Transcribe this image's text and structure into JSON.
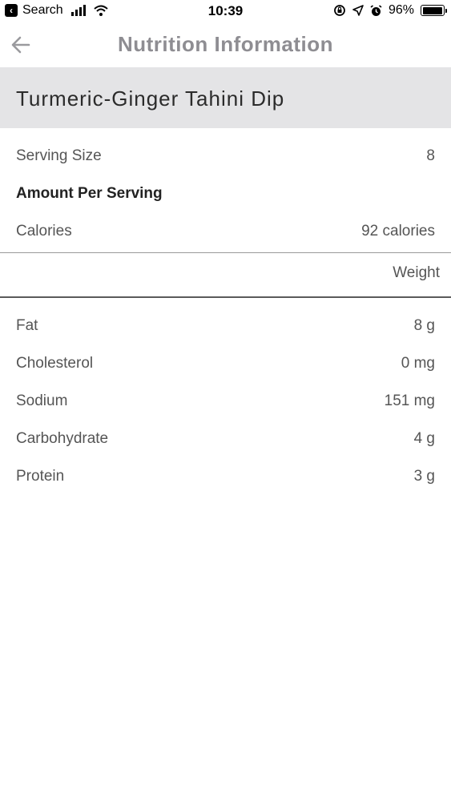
{
  "status_bar": {
    "back_app": "Search",
    "time": "10:39",
    "battery": "96%",
    "battery_level": 0.96
  },
  "header": {
    "title": "Nutrition Information"
  },
  "recipe": {
    "name": "Turmeric-Ginger Tahini Dip"
  },
  "summary": {
    "serving_size_label": "Serving Size",
    "serving_size_value": "8",
    "amount_per_serving": "Amount Per Serving",
    "calories_label": "Calories",
    "calories_value": "92 calories"
  },
  "table": {
    "column_header": "Weight",
    "rows": [
      {
        "label": "Fat",
        "value": "8 g"
      },
      {
        "label": "Cholesterol",
        "value": "0 mg"
      },
      {
        "label": "Sodium",
        "value": "151 mg"
      },
      {
        "label": "Carbohydrate",
        "value": "4 g"
      },
      {
        "label": "Protein",
        "value": "3 g"
      }
    ]
  }
}
